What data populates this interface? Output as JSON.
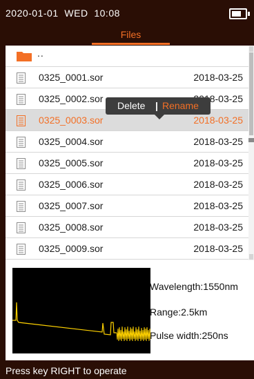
{
  "status": {
    "date": "2020-01-01",
    "weekday": "WED",
    "time": "10:08",
    "battery_icon": "battery-icon"
  },
  "tabs": [
    {
      "label": "Files",
      "active": true
    }
  ],
  "file_list": {
    "parent": {
      "label": "..",
      "icon": "folder-icon"
    },
    "rows": [
      {
        "name": "0325_0001.sor",
        "date": "2018-03-25",
        "selected": false
      },
      {
        "name": "0325_0002.sor",
        "date": "2018-03-25",
        "selected": false
      },
      {
        "name": "0325_0003.sor",
        "date": "2018-03-25",
        "selected": true
      },
      {
        "name": "0325_0004.sor",
        "date": "2018-03-25",
        "selected": false
      },
      {
        "name": "0325_0005.sor",
        "date": "2018-03-25",
        "selected": false
      },
      {
        "name": "0325_0006.sor",
        "date": "2018-03-25",
        "selected": false
      },
      {
        "name": "0325_0007.sor",
        "date": "2018-03-25",
        "selected": false
      },
      {
        "name": "0325_0008.sor",
        "date": "2018-03-25",
        "selected": false
      },
      {
        "name": "0325_0009.sor",
        "date": "2018-03-25",
        "selected": false
      }
    ]
  },
  "context_menu": {
    "delete_label": "Delete",
    "separator": "|",
    "rename_label": "Rename"
  },
  "preview": {
    "wavelength": "Wavelength:1550nm",
    "range": "Range:2.5km",
    "pulse_width": "Pulse width:250ns"
  },
  "hint": "Press key RIGHT to operate",
  "colors": {
    "accent": "#f36f25",
    "background": "#2a0e05",
    "trace": "#ffd200"
  }
}
